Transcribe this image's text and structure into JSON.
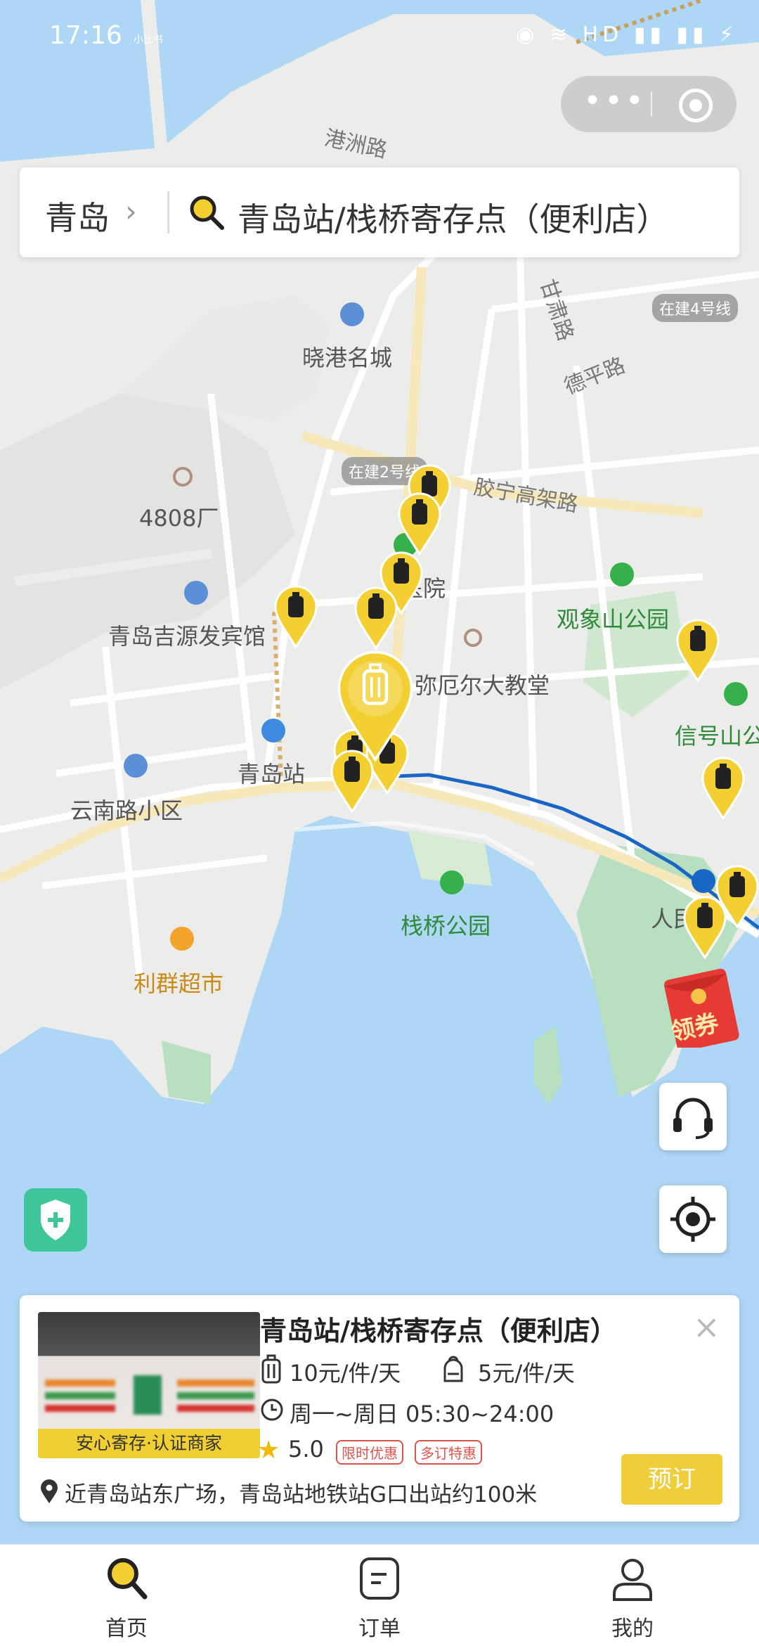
{
  "status_bar": {
    "time": "17:16",
    "small_text": "小比书",
    "icons": "◉ ≋ HD ▮▮ ▮▮ ⚡"
  },
  "search": {
    "city": "青岛",
    "query": "青岛站/栈桥寄存点（便利店）"
  },
  "map": {
    "places": [
      "港洲路",
      "晓港名城",
      "4808厂",
      "青岛吉源发宾馆",
      "青岛站",
      "云南路小区",
      "利群超市",
      "栈桥公园",
      "观象山公园",
      "信号山公",
      "人民会",
      "德平路",
      "胶宁高架路",
      "甘肃路",
      "弥厄尔大教堂",
      "医院"
    ],
    "tags": [
      "在建4号线",
      "在建2号线"
    ],
    "colors": {
      "water": "#aed6f5",
      "land": "#ececea",
      "park": "#b8e0c0",
      "metro_line": "#1a66c7",
      "pin": "#f3cf31"
    }
  },
  "coupon": {
    "label": "领券"
  },
  "store": {
    "title": "青岛站/栈桥寄存点（便利店）",
    "thumb_label": "安心寄存·认证商家",
    "price_luggage": "10元/件/天",
    "price_bag": "5元/件/天",
    "hours": "周一~周日 05:30~24:00",
    "rating": "5.0",
    "badges": [
      "限时优惠",
      "多订特惠"
    ],
    "address": "近青岛站东广场，青岛站地铁站G口出站约100米",
    "book_label": "预订",
    "close_label": "×"
  },
  "tabs": [
    {
      "label": "首页",
      "icon": "search-icon"
    },
    {
      "label": "订单",
      "icon": "order-icon"
    },
    {
      "label": "我的",
      "icon": "profile-icon"
    }
  ]
}
